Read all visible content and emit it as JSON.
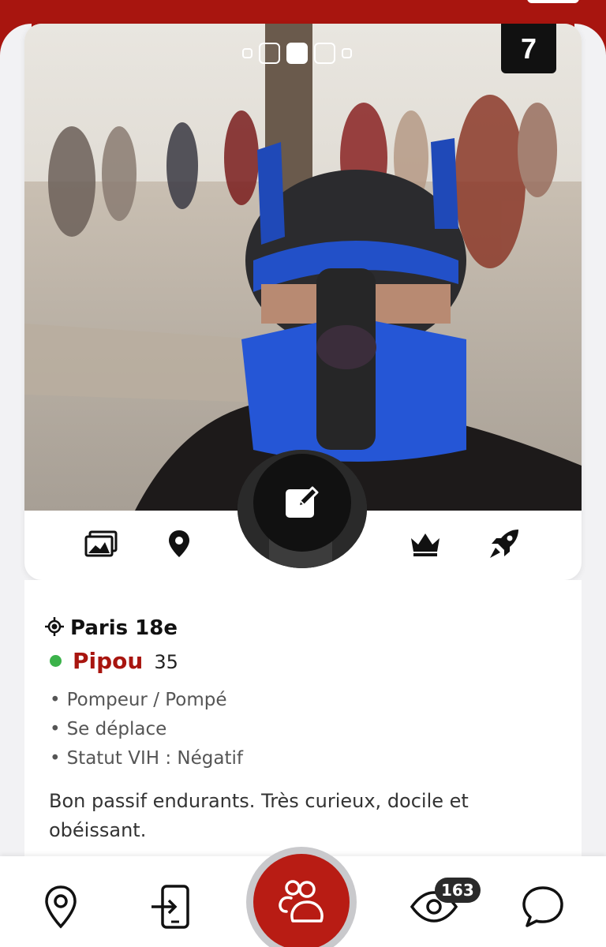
{
  "header": {
    "accent_color": "#a8150f"
  },
  "profile_card": {
    "photo_count": "7",
    "carousel": {
      "total_dots": 5,
      "active_index": 2
    },
    "actions": {
      "photos_icon": "images-icon",
      "location_icon": "map-pin-icon",
      "edit_icon": "edit-icon",
      "premium_icon": "crown-icon",
      "boost_icon": "rocket-icon"
    }
  },
  "info": {
    "location": "Paris 18e",
    "name": "Pipou",
    "age": "35",
    "online": true,
    "traits": [
      "Pompeur / Pompé",
      "Se déplace",
      "Statut VIH : Négatif"
    ],
    "bio": "Bon passif endurants. Très curieux, docile et obéissant."
  },
  "bottom_nav": {
    "items": [
      {
        "icon": "map-pin-icon"
      },
      {
        "icon": "phone-login-icon"
      },
      {
        "icon": "users-icon"
      },
      {
        "icon": "eye-icon",
        "badge": "163"
      },
      {
        "icon": "chat-icon"
      }
    ]
  }
}
